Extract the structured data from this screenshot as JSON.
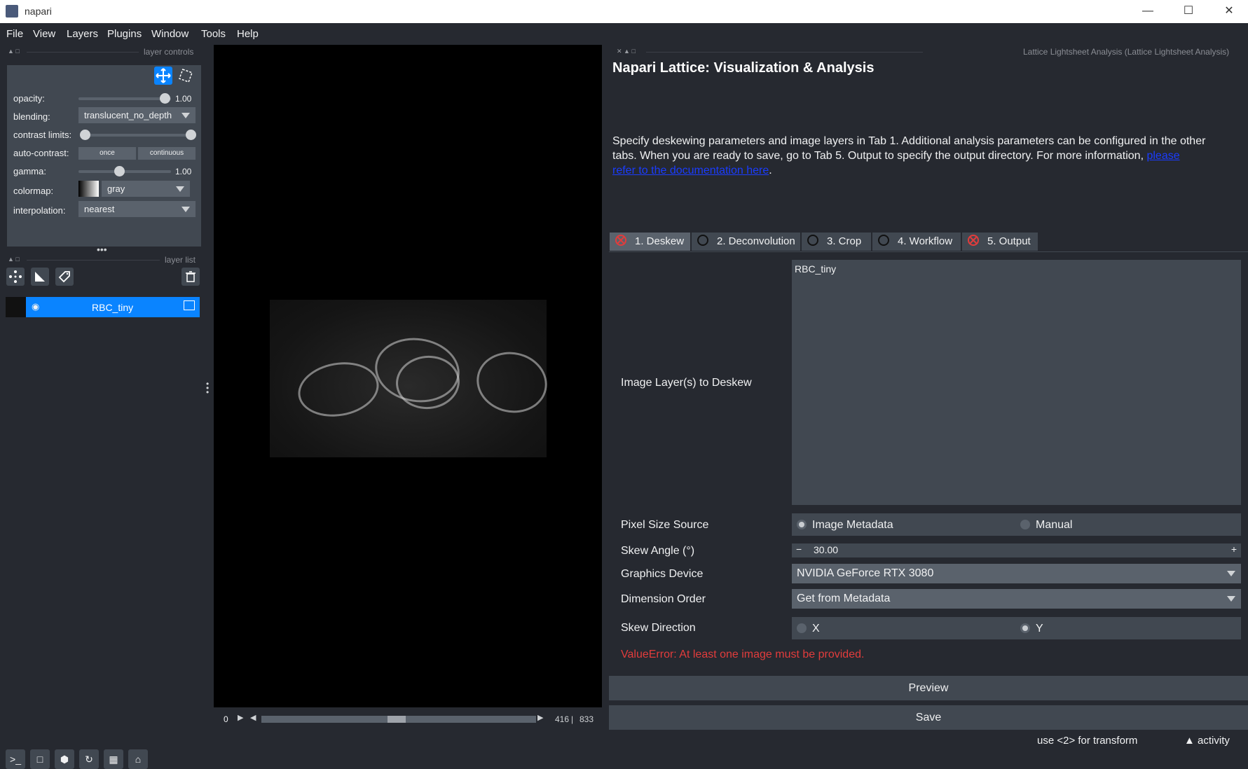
{
  "window": {
    "title": "napari"
  },
  "menu": [
    "File",
    "View",
    "Layers",
    "Plugins",
    "Window",
    "Tools",
    "Help"
  ],
  "layer_controls": {
    "dock_title": "layer controls",
    "opacity_label": "opacity:",
    "opacity_value": "1.00",
    "opacity_level": 1.0,
    "blending_label": "blending:",
    "blending_value": "translucent_no_depth",
    "contrast_label": "contrast limits:",
    "auto_contrast_label": "auto-contrast:",
    "once_label": "once",
    "continuous_label": "continuous",
    "gamma_label": "gamma:",
    "gamma_value": "1.00",
    "colormap_label": "colormap:",
    "colormap_value": "gray",
    "interpolation_label": "interpolation:",
    "interpolation_value": "nearest"
  },
  "layer_list": {
    "dock_title": "layer list",
    "layers": [
      {
        "name": "RBC_tiny",
        "visible": true
      }
    ]
  },
  "dims": {
    "start": "0",
    "current": "416",
    "total": "833"
  },
  "plugin": {
    "dock_title": "Lattice Lightsheet Analysis (Lattice Lightsheet Analysis)",
    "heading": "Napari Lattice: Visualization & Analysis",
    "desc_line1": "Specify deskewing parameters and image layers in Tab 1.  Additional analysis parameters can be configured in the other",
    "desc_line2": "tabs.  When you are ready to save, go to Tab 5.  Output to specify the output directory.  For more information, ",
    "desc_link_a": "please",
    "desc_link_b": "refer to the documentation here",
    "desc_end": ".",
    "tabs": [
      {
        "label": "1. Deskew",
        "status": "error"
      },
      {
        "label": "2. Deconvolution",
        "status": "pending"
      },
      {
        "label": "3. Crop",
        "status": "pending"
      },
      {
        "label": "4. Workflow",
        "status": "pending"
      },
      {
        "label": "5. Output",
        "status": "error"
      }
    ],
    "image_layers_label": "Image Layer(s) to Deskew",
    "image_layers_items": [
      "RBC_tiny"
    ],
    "pixel_size_label": "Pixel Size Source",
    "pixel_size_options": [
      "Image Metadata",
      "Manual"
    ],
    "pixel_size_selected": "Image Metadata",
    "skew_angle_label": "Skew Angle (°)",
    "skew_angle_value": "30.00",
    "graphics_label": "Graphics Device",
    "graphics_value": "NVIDIA GeForce RTX 3080",
    "dim_order_label": "Dimension Order",
    "dim_order_value": "Get from Metadata",
    "skew_dir_label": "Skew Direction",
    "skew_dir_options": [
      "X",
      "Y"
    ],
    "skew_dir_selected": "Y",
    "error_text": "ValueError: At least one image must be provided.",
    "preview_label": "Preview",
    "save_label": "Save"
  },
  "status": {
    "hint": "use <2> for transform",
    "activity": "activity"
  },
  "colors": {
    "accent": "#0a84ff",
    "error": "#e23c3c",
    "link": "#1a3cff",
    "background": "#262930"
  }
}
